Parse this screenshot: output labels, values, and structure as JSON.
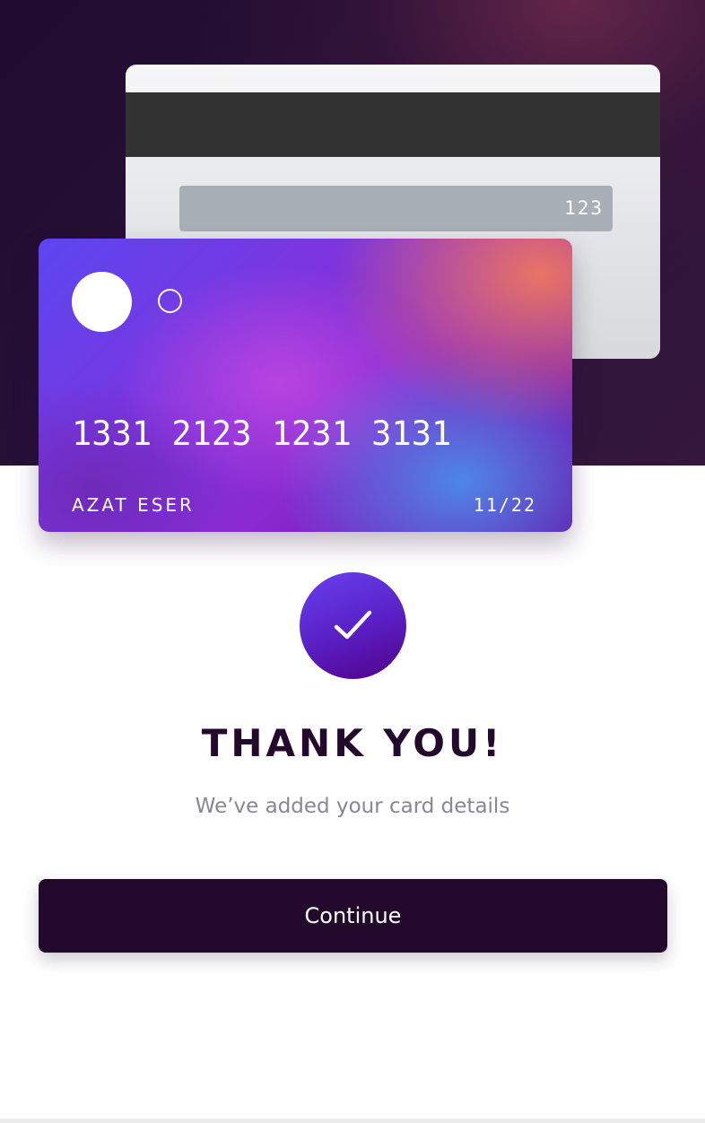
{
  "card_back": {
    "cvv": "123"
  },
  "card_front": {
    "number": "1331 2123 1231 3131",
    "holder": "AZAT ESER",
    "expiry": "11/22"
  },
  "success": {
    "icon": "checkmark-icon",
    "title": "THANK YOU!",
    "subtitle": "We’ve added your card details"
  },
  "actions": {
    "continue_label": "Continue"
  },
  "colors": {
    "dark_purple": "#230a2d",
    "accent_violet": "#6840ee",
    "subtitle_gray": "#8a8590",
    "background": "#ffffff"
  }
}
